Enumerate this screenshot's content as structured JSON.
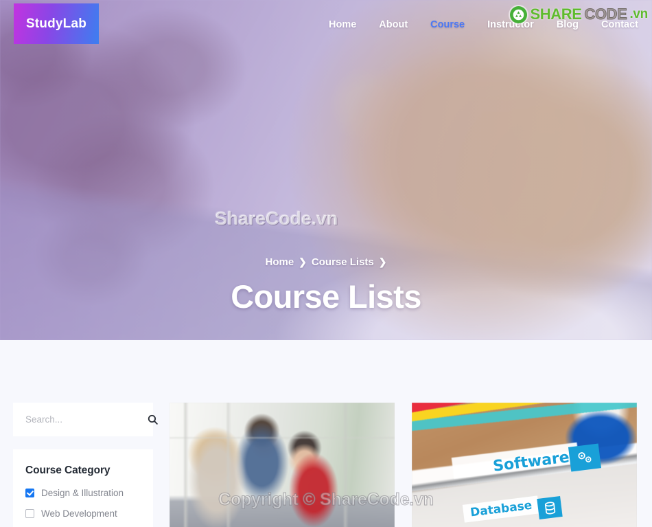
{
  "site": {
    "logo_text": "StudyLab"
  },
  "nav": {
    "items": [
      {
        "label": "Home",
        "active": false
      },
      {
        "label": "About",
        "active": false
      },
      {
        "label": "Course",
        "active": true
      },
      {
        "label": "Instructor",
        "active": false
      },
      {
        "label": "Blog",
        "active": false
      },
      {
        "label": "Contact",
        "active": false
      }
    ]
  },
  "hero": {
    "title": "Course Lists",
    "breadcrumb": [
      {
        "label": "Home",
        "sep": "❯"
      },
      {
        "label": "Course Lists",
        "sep": "❯"
      }
    ]
  },
  "watermarks": {
    "logo_share": "SHARE",
    "logo_code": "CODE",
    "logo_vn": ".vn",
    "hero_text": "ShareCode.vn",
    "copyright": "Copyright © ShareCode.vn"
  },
  "sidebar": {
    "search": {
      "placeholder": "Search...",
      "value": "",
      "icon": "search-icon"
    },
    "category": {
      "title": "Course Category",
      "items": [
        {
          "label": "Design & Illustration",
          "checked": true
        },
        {
          "label": "Web Development",
          "checked": false
        }
      ]
    }
  },
  "courses": {
    "cards": [
      {
        "image_alt": "students-collaborating-at-laptop"
      },
      {
        "image_alt": "software-database-tablet-on-desk",
        "label_primary": "Software",
        "label_secondary": "Database"
      }
    ]
  },
  "colors": {
    "accent_blue": "#1677f2",
    "nav_active": "#4a78f5",
    "logo_gradient_start": "#c233e0",
    "logo_gradient_end": "#3d7ef0",
    "page_bg": "#f7f8fd",
    "watermark_green": "#5fbb2e"
  }
}
